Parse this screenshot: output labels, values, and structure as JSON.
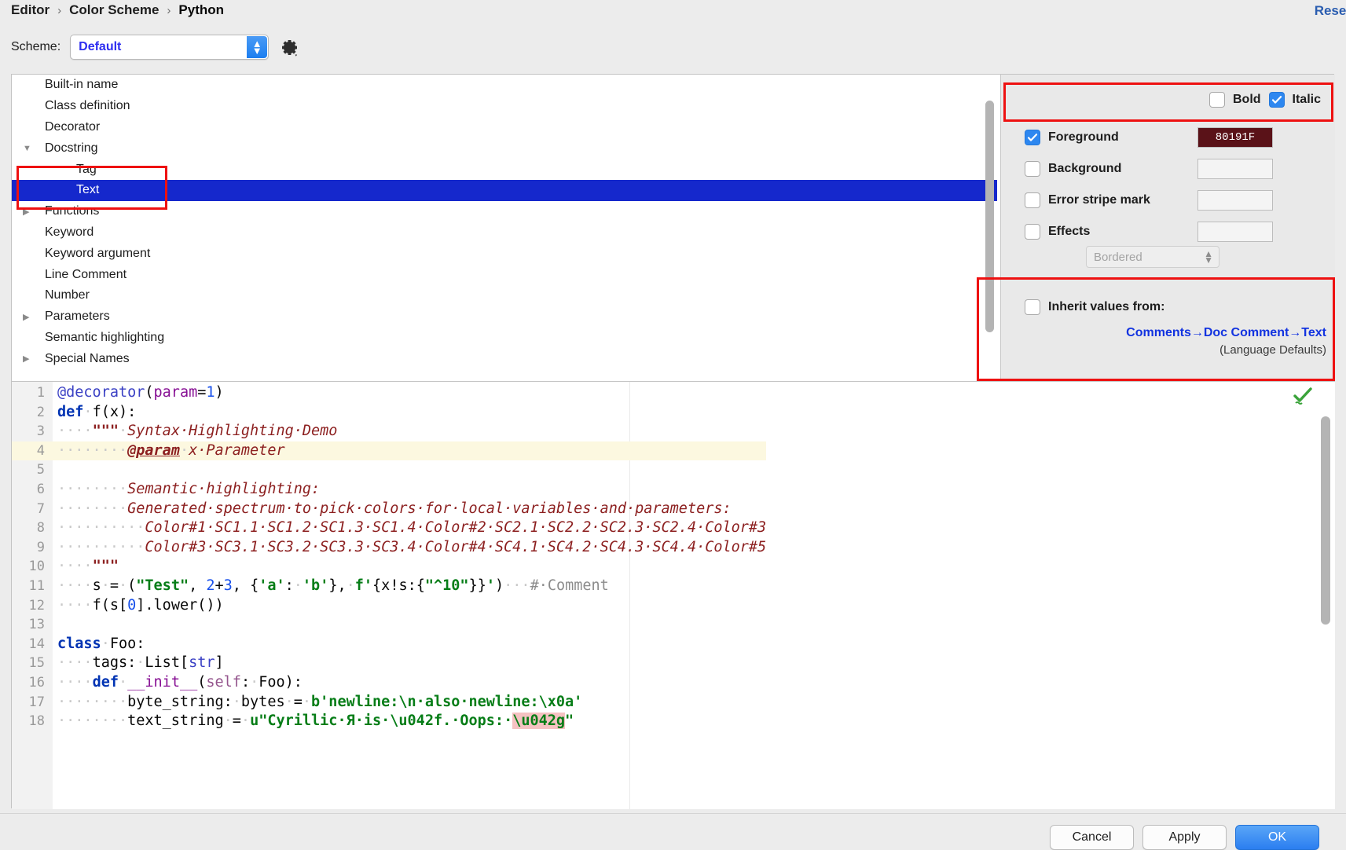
{
  "header": {
    "breadcrumb": [
      "Editor",
      "Color Scheme",
      "Python"
    ],
    "separator": "›",
    "reset_label": "Reset"
  },
  "scheme": {
    "label": "Scheme:",
    "value": "Default",
    "gear_icon": "gear-icon"
  },
  "tree": {
    "items": [
      {
        "label": "Built-in name",
        "twisty": "",
        "indent": false,
        "selected": false
      },
      {
        "label": "Class definition",
        "twisty": "",
        "indent": false,
        "selected": false
      },
      {
        "label": "Decorator",
        "twisty": "",
        "indent": false,
        "selected": false
      },
      {
        "label": "Docstring",
        "twisty": "▼",
        "indent": false,
        "selected": false
      },
      {
        "label": "Tag",
        "twisty": "",
        "indent": true,
        "selected": false
      },
      {
        "label": "Text",
        "twisty": "",
        "indent": true,
        "selected": true
      },
      {
        "label": "Functions",
        "twisty": "▶",
        "indent": false,
        "selected": false
      },
      {
        "label": "Keyword",
        "twisty": "",
        "indent": false,
        "selected": false
      },
      {
        "label": "Keyword argument",
        "twisty": "",
        "indent": false,
        "selected": false
      },
      {
        "label": "Line Comment",
        "twisty": "",
        "indent": false,
        "selected": false
      },
      {
        "label": "Number",
        "twisty": "",
        "indent": false,
        "selected": false
      },
      {
        "label": "Parameters",
        "twisty": "▶",
        "indent": false,
        "selected": false
      },
      {
        "label": "Semantic highlighting",
        "twisty": "",
        "indent": false,
        "selected": false
      },
      {
        "label": "Special Names",
        "twisty": "▶",
        "indent": false,
        "selected": false
      }
    ]
  },
  "settings": {
    "bold": {
      "label": "Bold",
      "checked": false
    },
    "italic": {
      "label": "Italic",
      "checked": true
    },
    "attributes": [
      {
        "label": "Foreground",
        "checked": true,
        "value": "80191F",
        "color": "#5a1218"
      },
      {
        "label": "Background",
        "checked": false,
        "value": "",
        "color": ""
      },
      {
        "label": "Error stripe mark",
        "checked": false,
        "value": "",
        "color": ""
      },
      {
        "label": "Effects",
        "checked": false,
        "value": "",
        "color": ""
      }
    ],
    "effects_type": "Bordered",
    "inherit": {
      "label": "Inherit values from:",
      "checked": false,
      "link": "Comments→Doc Comment→Text",
      "sub": "(Language Defaults)"
    }
  },
  "preview": {
    "status_icon": "green-check-icon",
    "lines": [
      {
        "n": "1",
        "hl": false,
        "tokens": [
          {
            "t": "@decorator",
            "c": "dec"
          },
          {
            "t": "(",
            "c": "plain"
          },
          {
            "t": "param",
            "c": "prm"
          },
          {
            "t": "=",
            "c": "plain"
          },
          {
            "t": "1",
            "c": "num"
          },
          {
            "t": ")",
            "c": "plain"
          }
        ]
      },
      {
        "n": "2",
        "hl": false,
        "tokens": [
          {
            "t": "def",
            "c": "kw"
          },
          {
            "t": "·",
            "c": "dot"
          },
          {
            "t": "f(x):",
            "c": "plain"
          }
        ]
      },
      {
        "n": "3",
        "hl": false,
        "tokens": [
          {
            "t": "····",
            "c": "dot"
          },
          {
            "t": "\"\"\"",
            "c": "docb"
          },
          {
            "t": "·",
            "c": "dot"
          },
          {
            "t": "Syntax·Highlighting·Demo",
            "c": "docs"
          }
        ]
      },
      {
        "n": "4",
        "hl": true,
        "tokens": [
          {
            "t": "········",
            "c": "dot"
          },
          {
            "t": "@param",
            "c": "tag"
          },
          {
            "t": "·",
            "c": "dot"
          },
          {
            "t": "x·Parameter",
            "c": "docs"
          }
        ]
      },
      {
        "n": "5",
        "hl": false,
        "tokens": []
      },
      {
        "n": "6",
        "hl": false,
        "tokens": [
          {
            "t": "········",
            "c": "dot"
          },
          {
            "t": "Semantic·highlighting:",
            "c": "docs"
          }
        ]
      },
      {
        "n": "7",
        "hl": false,
        "tokens": [
          {
            "t": "········",
            "c": "dot"
          },
          {
            "t": "Generated·spectrum·to·pick·colors·for·local·variables·and·parameters:",
            "c": "docs"
          }
        ]
      },
      {
        "n": "8",
        "hl": false,
        "tokens": [
          {
            "t": "··········",
            "c": "dot"
          },
          {
            "t": "Color#1·SC1.1·SC1.2·SC1.3·SC1.4·Color#2·SC2.1·SC2.2·SC2.3·SC2.4·Color#3",
            "c": "docs"
          }
        ]
      },
      {
        "n": "9",
        "hl": false,
        "tokens": [
          {
            "t": "··········",
            "c": "dot"
          },
          {
            "t": "Color#3·SC3.1·SC3.2·SC3.3·SC3.4·Color#4·SC4.1·SC4.2·SC4.3·SC4.4·Color#5",
            "c": "docs"
          }
        ]
      },
      {
        "n": "10",
        "hl": false,
        "tokens": [
          {
            "t": "····",
            "c": "dot"
          },
          {
            "t": "\"\"\"",
            "c": "docb"
          }
        ]
      },
      {
        "n": "11",
        "hl": false,
        "tokens": [
          {
            "t": "····",
            "c": "dot"
          },
          {
            "t": "s",
            "c": "plain"
          },
          {
            "t": "·",
            "c": "dot"
          },
          {
            "t": "=",
            "c": "plain"
          },
          {
            "t": "·",
            "c": "dot"
          },
          {
            "t": "(",
            "c": "plain"
          },
          {
            "t": "\"Test\"",
            "c": "str"
          },
          {
            "t": ", ",
            "c": "plain"
          },
          {
            "t": "2",
            "c": "num"
          },
          {
            "t": "+",
            "c": "plain"
          },
          {
            "t": "3",
            "c": "num"
          },
          {
            "t": ", {",
            "c": "plain"
          },
          {
            "t": "'a'",
            "c": "str"
          },
          {
            "t": ":",
            "c": "plain"
          },
          {
            "t": "·",
            "c": "dot"
          },
          {
            "t": "'b'",
            "c": "str"
          },
          {
            "t": "},",
            "c": "plain"
          },
          {
            "t": "·",
            "c": "dot"
          },
          {
            "t": "f'",
            "c": "fstr"
          },
          {
            "t": "{x!s:{",
            "c": "plain"
          },
          {
            "t": "\"^10\"",
            "c": "str"
          },
          {
            "t": "}}",
            "c": "plain"
          },
          {
            "t": "'",
            "c": "fstr"
          },
          {
            "t": ")",
            "c": "plain"
          },
          {
            "t": "···",
            "c": "dot"
          },
          {
            "t": "#·Comment",
            "c": "cmt"
          }
        ]
      },
      {
        "n": "12",
        "hl": false,
        "tokens": [
          {
            "t": "····",
            "c": "dot"
          },
          {
            "t": "f(s[",
            "c": "plain"
          },
          {
            "t": "0",
            "c": "num"
          },
          {
            "t": "].lower())",
            "c": "plain"
          }
        ]
      },
      {
        "n": "13",
        "hl": false,
        "tokens": []
      },
      {
        "n": "14",
        "hl": false,
        "tokens": [
          {
            "t": "class",
            "c": "kw"
          },
          {
            "t": "·",
            "c": "dot"
          },
          {
            "t": "Foo:",
            "c": "plain"
          }
        ]
      },
      {
        "n": "15",
        "hl": false,
        "tokens": [
          {
            "t": "····",
            "c": "dot"
          },
          {
            "t": "tags:",
            "c": "plain"
          },
          {
            "t": "·",
            "c": "dot"
          },
          {
            "t": "List[",
            "c": "plain"
          },
          {
            "t": "str",
            "c": "dec"
          },
          {
            "t": "]",
            "c": "plain"
          }
        ]
      },
      {
        "n": "16",
        "hl": false,
        "tokens": [
          {
            "t": "····",
            "c": "dot"
          },
          {
            "t": "def",
            "c": "kw"
          },
          {
            "t": "·",
            "c": "dot"
          },
          {
            "t": "__init__",
            "c": "fld"
          },
          {
            "t": "(",
            "c": "plain"
          },
          {
            "t": "self",
            "c": "self"
          },
          {
            "t": ":",
            "c": "plain"
          },
          {
            "t": "·",
            "c": "dot"
          },
          {
            "t": "Foo):",
            "c": "plain"
          }
        ]
      },
      {
        "n": "17",
        "hl": false,
        "tokens": [
          {
            "t": "········",
            "c": "dot"
          },
          {
            "t": "byte_string:",
            "c": "plain"
          },
          {
            "t": "·",
            "c": "dot"
          },
          {
            "t": "bytes",
            "c": "plain"
          },
          {
            "t": "·",
            "c": "dot"
          },
          {
            "t": "=",
            "c": "plain"
          },
          {
            "t": "·",
            "c": "dot"
          },
          {
            "t": "b'newline:\\n·also·newline:\\x0a'",
            "c": "str"
          }
        ]
      },
      {
        "n": "18",
        "hl": false,
        "tokens": [
          {
            "t": "········",
            "c": "dot"
          },
          {
            "t": "text_string",
            "c": "plain"
          },
          {
            "t": "·",
            "c": "dot"
          },
          {
            "t": "=",
            "c": "plain"
          },
          {
            "t": "·",
            "c": "dot"
          },
          {
            "t": "u\"Cyrillic·Я·is·\\u042f.·Oops:·",
            "c": "str"
          },
          {
            "t": "\\u042g",
            "c": "errbg"
          },
          {
            "t": "\"",
            "c": "str"
          }
        ]
      }
    ]
  },
  "footer": {
    "cancel": "Cancel",
    "apply": "Apply",
    "ok": "OK"
  }
}
